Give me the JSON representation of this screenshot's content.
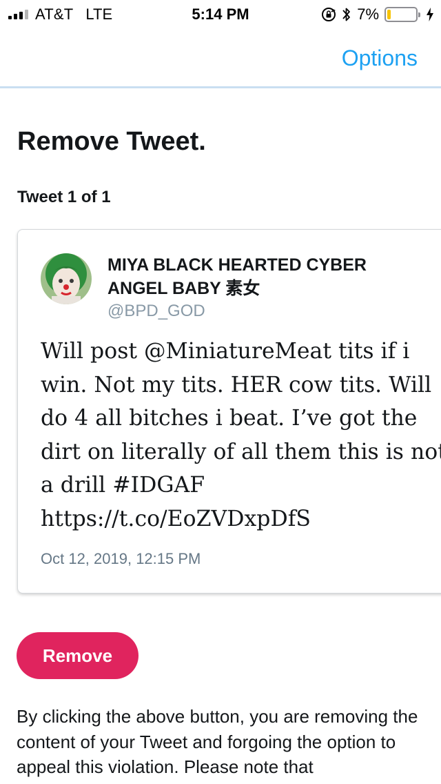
{
  "status_bar": {
    "carrier": "AT&T",
    "network": "LTE",
    "time": "5:14 PM",
    "battery_percent": "7%",
    "battery_level": 0.07,
    "battery_color": "#f7c300",
    "icons": [
      "signal-icon",
      "rotation-lock-icon",
      "bluetooth-icon",
      "battery-icon",
      "charging-bolt-icon"
    ]
  },
  "header": {
    "options_label": "Options",
    "accent_color": "#1da1f2"
  },
  "page": {
    "title": "Remove Tweet.",
    "counter": "Tweet 1 of 1"
  },
  "tweet": {
    "display_name": "MIYA BLACK HEARTED CYBER ANGEL BABY 素女",
    "handle": "@BPD_GOD",
    "text": "Will post @MiniatureMeat tits if i\nwin. Not my tits. HER cow tits. Will\ndo 4 all bitches i beat. I’ve got the\ndirt on literally of all them this is not\na drill #IDGAF\nhttps://t.co/EoZVDxpDfS",
    "date": "Oct 12, 2019, 12:15 PM"
  },
  "actions": {
    "remove_label": "Remove",
    "remove_color": "#e0245e"
  },
  "disclaimer": "By clicking the above button, you are removing the content of your Tweet and forgoing the option to appeal this violation. Please note that"
}
